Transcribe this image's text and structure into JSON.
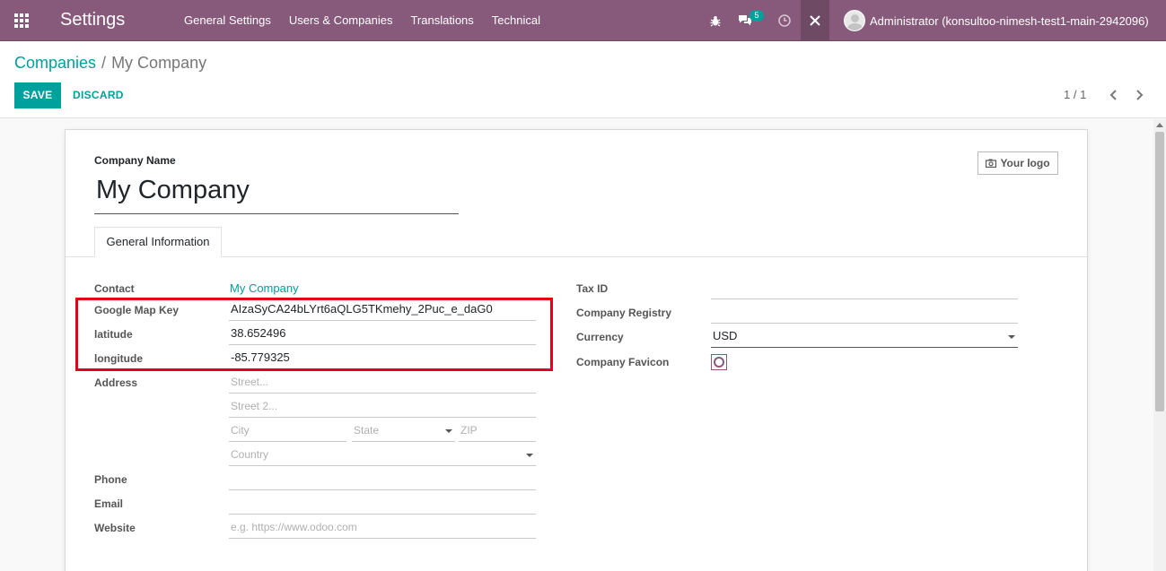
{
  "navbar": {
    "app_title": "Settings",
    "menu": [
      "General Settings",
      "Users & Companies",
      "Translations",
      "Technical"
    ],
    "messages_badge": "5",
    "user_name": "Administrator (konsultoo-nimesh-test1-main-2942096)",
    "bg_color": "#875a7b"
  },
  "breadcrumb": {
    "parent": "Companies",
    "separator": "/",
    "current": "My Company"
  },
  "buttons": {
    "save": "SAVE",
    "discard": "DISCARD"
  },
  "pager": {
    "value": "1 / 1"
  },
  "form": {
    "company_name_label": "Company Name",
    "company_name": "My Company",
    "logo_button": "Your logo",
    "tab": "General Information",
    "left": {
      "contact": {
        "label": "Contact",
        "value": "My Company"
      },
      "google_map_key": {
        "label": "Google Map Key",
        "value": "AIzaSyCA24bLYrt6aQLG5TKmehy_2Puc_e_daG0"
      },
      "latitude": {
        "label": "latitude",
        "value": "38.652496"
      },
      "longitude": {
        "label": "longitude",
        "value": "-85.779325"
      },
      "address": {
        "label": "Address",
        "street_placeholder": "Street...",
        "street2_placeholder": "Street 2...",
        "city_placeholder": "City",
        "state_placeholder": "State",
        "zip_placeholder": "ZIP",
        "country_placeholder": "Country"
      },
      "phone": {
        "label": "Phone",
        "value": ""
      },
      "email": {
        "label": "Email",
        "value": ""
      },
      "website": {
        "label": "Website",
        "placeholder": "e.g. https://www.odoo.com"
      }
    },
    "right": {
      "tax_id": {
        "label": "Tax ID",
        "value": ""
      },
      "company_registry": {
        "label": "Company Registry",
        "value": ""
      },
      "currency": {
        "label": "Currency",
        "value": "USD"
      },
      "company_favicon": {
        "label": "Company Favicon"
      }
    }
  },
  "accent_color": "#00a09d",
  "highlight_color": "#e2001a"
}
